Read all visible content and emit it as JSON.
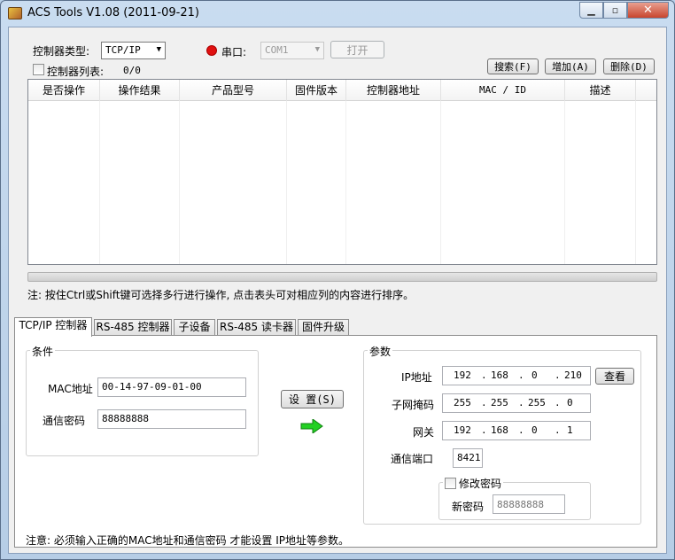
{
  "window": {
    "title": "ACS Tools V1.08 (2011-09-21)"
  },
  "top": {
    "controller_type_label": "控制器类型:",
    "controller_type_value": "TCP/IP",
    "serial_label": "串口:",
    "serial_value": "COM1",
    "open_button": "打开",
    "controller_list_label": "控制器列表:",
    "controller_count": "0/0",
    "search_button": "搜索(F)",
    "add_button": "增加(A)",
    "delete_button": "删除(D)",
    "status_color": "#e01010"
  },
  "grid": {
    "columns": [
      "是否操作",
      "操作结果",
      "产品型号",
      "固件版本",
      "控制器地址",
      "MAC / ID",
      "描述"
    ]
  },
  "hint": "注: 按住Ctrl或Shift键可选择多行进行操作, 点击表头可对相应列的内容进行排序。",
  "tabs": [
    "TCP/IP 控制器",
    "RS-485 控制器",
    "子设备",
    "RS-485 读卡器",
    "固件升级"
  ],
  "condition": {
    "title": "条件",
    "mac_label": "MAC地址",
    "mac_value": "00-14-97-09-01-00",
    "password_label": "通信密码",
    "password_value": "88888888"
  },
  "set_button": "设 置(S)",
  "params": {
    "title": "参数",
    "ip_label": "IP地址",
    "ip": [
      "192",
      "168",
      "0",
      "210"
    ],
    "view_button": "查看",
    "mask_label": "子网掩码",
    "mask": [
      "255",
      "255",
      "255",
      "0"
    ],
    "gateway_label": "网关",
    "gateway": [
      "192",
      "168",
      "0",
      "1"
    ],
    "port_label": "通信端口",
    "port_value": "8421",
    "change_password_label": "修改密码",
    "new_password_label": "新密码",
    "new_password_placeholder": "88888888"
  },
  "footer_note": "注意: 必须输入正确的MAC地址和通信密码 才能设置 IP地址等参数。"
}
